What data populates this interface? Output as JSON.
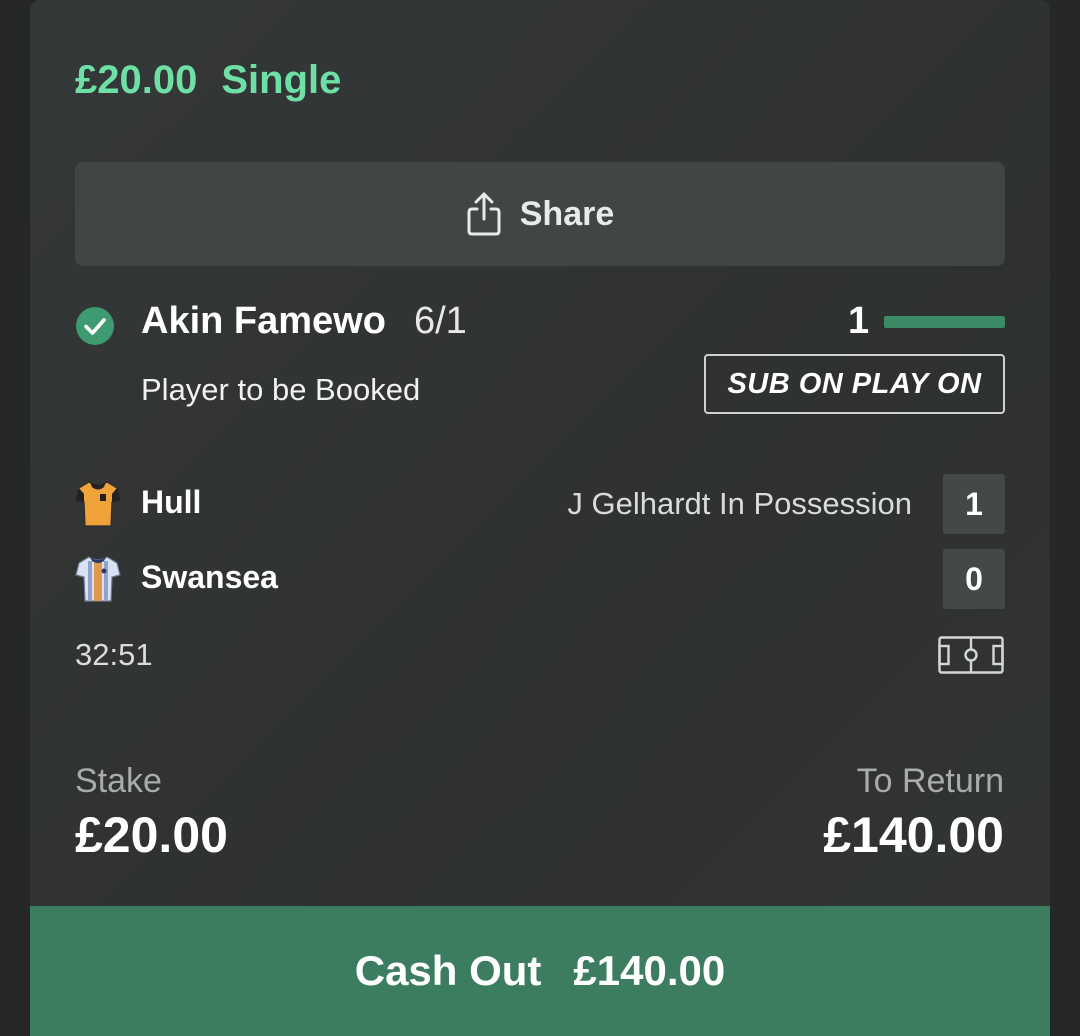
{
  "bet": {
    "stake_amount": "£20.00",
    "bet_type": "Single"
  },
  "share": {
    "label": "Share",
    "icon": "share-icon"
  },
  "selection": {
    "status_icon": "check-circle-icon",
    "name": "Akin Famewo",
    "odds": "6/1",
    "market": "Player to be Booked",
    "progress_count": "1",
    "progress_fraction": 1.0,
    "badge": "SUB ON PLAY ON"
  },
  "match": {
    "home": {
      "name": "Hull",
      "score": "1",
      "shirt_icon": "hull-shirt-icon"
    },
    "away": {
      "name": "Swansea",
      "score": "0",
      "shirt_icon": "swansea-shirt-icon"
    },
    "possession_text": "J Gelhardt In Possession",
    "clock": "32:51",
    "pitch_icon": "pitch-icon"
  },
  "stake": {
    "label": "Stake",
    "value": "£20.00"
  },
  "to_return": {
    "label": "To Return",
    "value": "£140.00"
  },
  "cashout": {
    "label": "Cash Out",
    "value": "£140.00"
  },
  "colors": {
    "accent_green": "#6ee0a6",
    "cashout_green": "#3b7d5e",
    "card_bg": "#333636"
  }
}
